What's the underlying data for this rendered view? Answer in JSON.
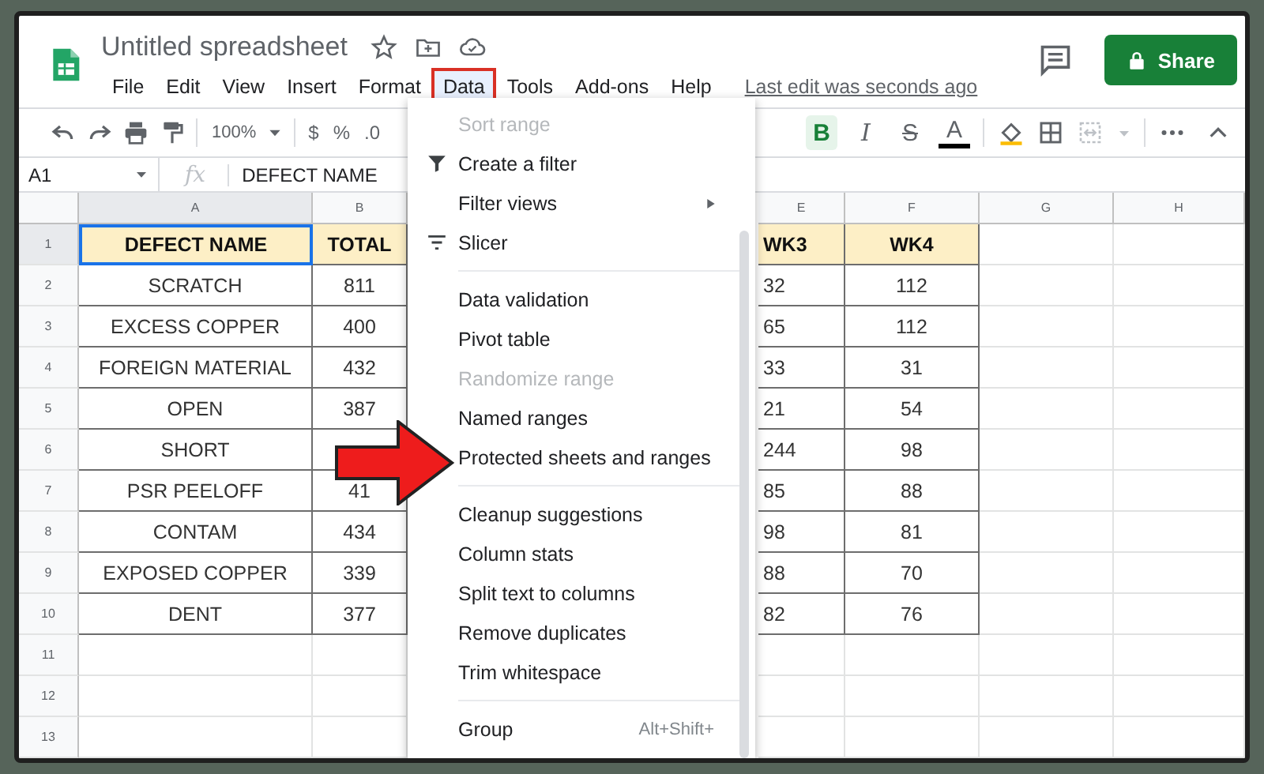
{
  "document": {
    "title": "Untitled spreadsheet",
    "last_edit": "Last edit was seconds ago"
  },
  "menu_bar": [
    {
      "label": "File",
      "selected": false
    },
    {
      "label": "Edit",
      "selected": false
    },
    {
      "label": "View",
      "selected": false
    },
    {
      "label": "Insert",
      "selected": false
    },
    {
      "label": "Format",
      "selected": false
    },
    {
      "label": "Data",
      "selected": true
    },
    {
      "label": "Tools",
      "selected": false
    },
    {
      "label": "Add-ons",
      "selected": false
    },
    {
      "label": "Help",
      "selected": false
    }
  ],
  "share_button": {
    "label": "Share"
  },
  "toolbar": {
    "zoom": "100%",
    "number_formats": [
      "$",
      "%",
      ".0"
    ],
    "text_formats": [
      {
        "label": "B",
        "kind": "bold",
        "on": true
      },
      {
        "label": "I",
        "kind": "italic",
        "on": false
      },
      {
        "label": "S",
        "kind": "strike",
        "on": false
      },
      {
        "label": "A",
        "kind": "color",
        "on": false
      }
    ]
  },
  "formula_bar": {
    "cell_ref": "A1",
    "fx": "fx",
    "value": "DEFECT NAME"
  },
  "table": {
    "columns": [
      {
        "label": "A",
        "selected": true
      },
      {
        "label": "B",
        "selected": false
      },
      {
        "label": "E",
        "selected": false
      },
      {
        "label": "F",
        "selected": false
      },
      {
        "label": "G",
        "selected": false
      },
      {
        "label": "H",
        "selected": false
      }
    ],
    "rows": [
      {
        "number": "1",
        "selected": true,
        "kind": "header",
        "cells": {
          "a": "DEFECT NAME",
          "b": "TOTAL",
          "e": "WK3",
          "f": "WK4"
        }
      },
      {
        "number": "2",
        "selected": false,
        "kind": "data",
        "cells": {
          "a": "SCRATCH",
          "b": "811",
          "e": "32",
          "f": "112"
        }
      },
      {
        "number": "3",
        "selected": false,
        "kind": "data",
        "cells": {
          "a": "EXCESS COPPER",
          "b": "400",
          "e": "65",
          "f": "112"
        }
      },
      {
        "number": "4",
        "selected": false,
        "kind": "data",
        "cells": {
          "a": "FOREIGN MATERIAL",
          "b": "432",
          "e": "33",
          "f": "31"
        }
      },
      {
        "number": "5",
        "selected": false,
        "kind": "data",
        "cells": {
          "a": "OPEN",
          "b": "387",
          "e": "21",
          "f": "54"
        }
      },
      {
        "number": "6",
        "selected": false,
        "kind": "data",
        "cells": {
          "a": "SHORT",
          "e": "244",
          "f": "98"
        }
      },
      {
        "number": "7",
        "selected": false,
        "kind": "data",
        "cells": {
          "a": "PSR PEELOFF",
          "b": "41",
          "e": "85",
          "f": "88"
        }
      },
      {
        "number": "8",
        "selected": false,
        "kind": "data",
        "cells": {
          "a": "CONTAM",
          "b": "434",
          "e": "98",
          "f": "81"
        }
      },
      {
        "number": "9",
        "selected": false,
        "kind": "data",
        "cells": {
          "a": "EXPOSED COPPER",
          "b": "339",
          "e": "88",
          "f": "70"
        }
      },
      {
        "number": "10",
        "selected": false,
        "kind": "data",
        "cells": {
          "a": "DENT",
          "b": "377",
          "e": "82",
          "f": "76"
        }
      },
      {
        "number": "11",
        "selected": false,
        "kind": "empty",
        "cells": {}
      },
      {
        "number": "12",
        "selected": false,
        "kind": "empty",
        "cells": {}
      },
      {
        "number": "13",
        "selected": false,
        "kind": "empty",
        "cells": {}
      }
    ]
  },
  "data_menu": [
    {
      "kind": "item",
      "label": "Sort range",
      "disabled": true
    },
    {
      "kind": "filter",
      "label": "Create a filter",
      "disabled": false
    },
    {
      "kind": "item",
      "label": "Filter views",
      "submenu": true,
      "disabled": false
    },
    {
      "kind": "slicer",
      "label": "Slicer",
      "disabled": false
    },
    {
      "kind": "divider"
    },
    {
      "kind": "item",
      "label": "Data validation",
      "disabled": false
    },
    {
      "kind": "item",
      "label": "Pivot table",
      "disabled": false
    },
    {
      "kind": "item",
      "label": "Randomize range",
      "disabled": true
    },
    {
      "kind": "item",
      "label": "Named ranges",
      "disabled": false
    },
    {
      "kind": "item",
      "label": "Protected sheets and ranges",
      "disabled": false
    },
    {
      "kind": "divider"
    },
    {
      "kind": "item",
      "label": "Cleanup suggestions",
      "disabled": false
    },
    {
      "kind": "item",
      "label": "Column stats",
      "disabled": false
    },
    {
      "kind": "item",
      "label": "Split text to columns",
      "disabled": false
    },
    {
      "kind": "item",
      "label": "Remove duplicates",
      "disabled": false
    },
    {
      "kind": "item",
      "label": "Trim whitespace",
      "disabled": false
    },
    {
      "kind": "divider"
    },
    {
      "kind": "item",
      "label": "Group",
      "shortcut": "Alt+Shift+",
      "disabled": false
    }
  ]
}
